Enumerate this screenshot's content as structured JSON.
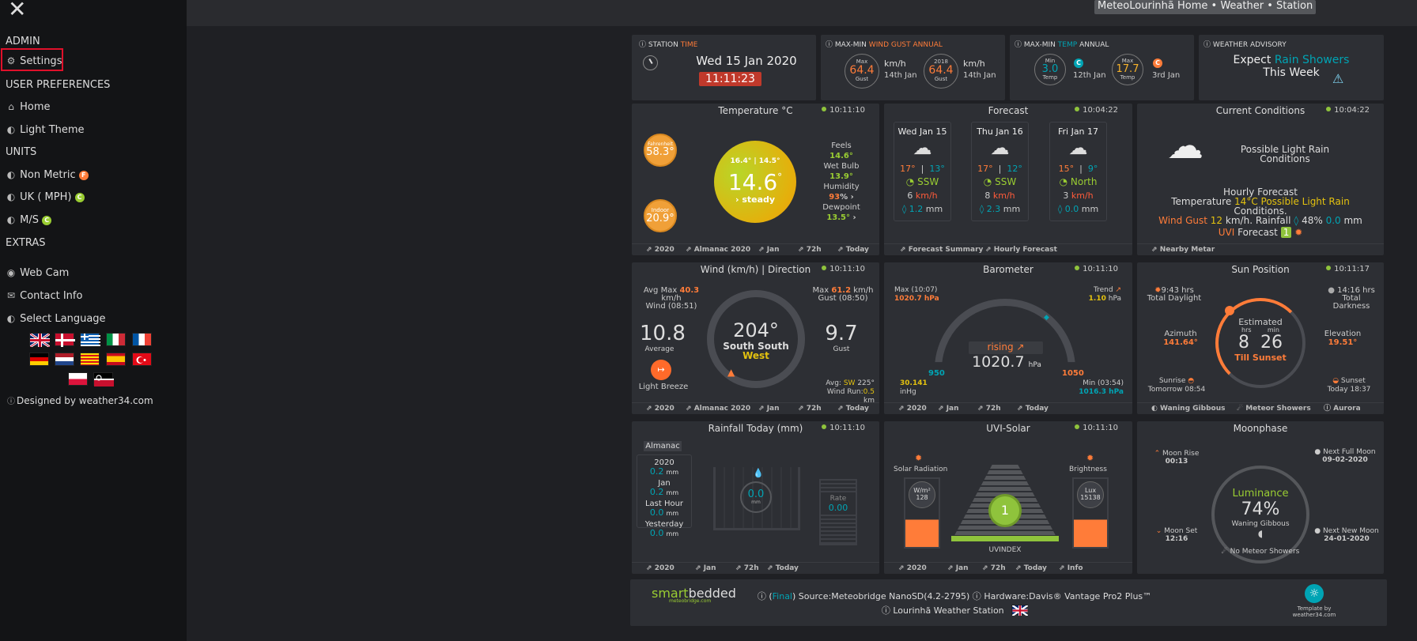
{
  "sidebar": {
    "admin": "ADMIN",
    "settings": "Settings",
    "user_prefs": "USER PREFERENCES",
    "home": "Home",
    "light_theme": "Light Theme",
    "units": "UNITS",
    "non_metric": "Non Metric",
    "non_metric_badge": "F",
    "uk": "UK ( MPH)",
    "uk_badge": "C",
    "ms": "M/S",
    "ms_badge": "C",
    "extras": "EXTRAS",
    "webcam": "Web Cam",
    "contact": "Contact Info",
    "language": "Select Language",
    "designed": "Designed by weather34.com"
  },
  "header": {
    "title": "MeteoLourinhã Home • Weather • Station"
  },
  "station": {
    "title1": "STATION",
    "title2": "TIME",
    "date": "Wed 15 Jan 2020",
    "time": "11:11:23"
  },
  "gust": {
    "title1": "MAX-MIN",
    "title2": "WIND GUST ANNUAL",
    "c1_top": "Max",
    "c1_val": "64.4",
    "c1_bot": "Gust",
    "c1_unit": "km/h",
    "c1_date": "14th Jan",
    "c2_top": "2018",
    "c2_val": "64.4",
    "c2_bot": "Gust",
    "c2_unit": "km/h",
    "c2_date": "14th Jan"
  },
  "tempannual": {
    "title1": "MAX-MIN",
    "title2": "TEMP",
    "title3": "ANNUAL",
    "c1_top": "Min",
    "c1_val": "3.0",
    "c1_bot": "Temp",
    "c1_date": "12th Jan",
    "c2_top": "Max",
    "c2_val": "17.7",
    "c2_bot": "Temp",
    "c2_date": "3rd Jan",
    "badge": "C"
  },
  "advisory": {
    "title": "WEATHER ADVISORY",
    "l1a": "Expect",
    "l1b": "Rain Showers",
    "l2": "This Week"
  },
  "temperature": {
    "title": "Temperature °C",
    "time": "10:11:10",
    "fah_label": "Fahrenheit",
    "fah_val": "58.3°",
    "in_label": "Indoor",
    "in_val": "20.9°",
    "hilo": "16.4° | 14.5°",
    "value": "14.6",
    "deg": "°",
    "trend": "steady",
    "feels_label": "Feels",
    "feels": "14.6°",
    "wetbulb_label": "Wet Bulb",
    "wetbulb": "13.9°",
    "humidity_label": "Humidity",
    "humidity": "93",
    "humidity_unit": "%",
    "dew_label": "Dewpoint",
    "dew": "13.5°",
    "f1": "2020",
    "f2": "Almanac 2020",
    "f3": "Jan",
    "f4": "72h",
    "f5": "Today"
  },
  "forecast": {
    "title": "Forecast",
    "time": "10:04:22",
    "days": [
      {
        "day": "Wed Jan 15",
        "hi": "17°",
        "lo": "13°",
        "dir": "SSW",
        "wind": "6",
        "wunit": "km/h",
        "rain": "1.2",
        "runit": "mm"
      },
      {
        "day": "Thu Jan 16",
        "hi": "17°",
        "lo": "12°",
        "dir": "SSW",
        "wind": "8",
        "wunit": "km/h",
        "rain": "2.3",
        "runit": "mm"
      },
      {
        "day": "Fri Jan 17",
        "hi": "15°",
        "lo": "9°",
        "dir": "North",
        "wind": "3",
        "wunit": "km/h",
        "rain": "0.0",
        "runit": "mm"
      }
    ],
    "f1": "Forecast Summary",
    "f2": "Hourly Forecast"
  },
  "current": {
    "title": "Current Conditions",
    "time": "10:04:22",
    "desc": "Possible Light Rain Conditions",
    "hf_title": "Hourly Forecast",
    "temp_label": "Temperature",
    "temp": "14°C",
    "cond": "Possible Light Rain",
    "cond2": "Conditions.",
    "gust_label": "Wind Gust",
    "gust": "12",
    "gust_unit": "km/h.",
    "rain_label": "Rainfall",
    "rain_pct": "48%",
    "rain": "0.0",
    "rain_unit": "mm",
    "uvi_label": "UVI",
    "uvi_fc": "Forecast",
    "uvi": "1",
    "f1": "Nearby Metar"
  },
  "wind": {
    "title": "Wind (km/h) | Direction",
    "time": "10:11:10",
    "avgmax_label": "Avg Max",
    "avgmax": "40.3",
    "avgmax_unit": "km/h",
    "avgmax_sub": "Wind (08:51)",
    "max_label": "Max",
    "max": "61.2",
    "max_unit": "km/h",
    "max_sub": "Gust (08:50)",
    "avg": "10.8",
    "avg_label": "Average",
    "deg": "204°",
    "dir1": "South South",
    "dir2": "West",
    "gust": "9.7",
    "gust_label": "Gust",
    "beaufort": "Light Breeze",
    "avgdir_label": "Avg:",
    "avgdir": "SW",
    "avgdir_deg": "225°",
    "run_label": "Wind Run:",
    "run": "0.5",
    "run_unit": "km",
    "f1": "2020",
    "f2": "Almanac 2020",
    "f3": "Jan",
    "f4": "72h",
    "f5": "Today"
  },
  "barometer": {
    "title": "Barometer",
    "time": "10:11:10",
    "max_label": "Max (10:07)",
    "max": "1020.7 hPa",
    "trend_label": "Trend",
    "trend": "1.10",
    "trend_unit": "hPa",
    "state": "rising",
    "value": "1020.7",
    "unit": "hPa",
    "low": "950",
    "high": "1050",
    "inhg": "30.141",
    "inhg_unit": "inHg",
    "min_label": "Min (03:54)",
    "min": "1016.3 hPa",
    "f1": "2020",
    "f2": "Jan",
    "f3": "72h",
    "f4": "Today"
  },
  "sun": {
    "title": "Sun Position",
    "time": "10:11:17",
    "daylight": "9:43 hrs",
    "daylight_label": "Total Daylight",
    "darkness": "14:16 hrs",
    "darkness_label": "Total Darkness",
    "az_label": "Azimuth",
    "az": "141.64°",
    "el_label": "Elevation",
    "el": "19.51°",
    "est": "Estimated",
    "hrs_label": "hrs",
    "min_label": "min",
    "hrs": "8",
    "mins": "26",
    "till": "Till Sunset",
    "sunrise_label": "Sunrise",
    "sunrise": "Tomorrow 08:54",
    "sunset_label": "Sunset",
    "sunset": "Today 18:37",
    "f1": "Waning Gibbous",
    "f2": "Meteor Showers",
    "f3": "Aurora"
  },
  "rain": {
    "title": "Rainfall Today (mm)",
    "time": "10:11:10",
    "almanac": "Almanac",
    "y": "2020",
    "y_val": "0.2",
    "mm": "mm",
    "m": "Jan",
    "m_val": "0.2",
    "lh": "Last Hour",
    "lh_val": "0.0",
    "yd": "Yesterday",
    "yd_val": "0.0",
    "value": "0.0",
    "unit": "mm",
    "rate_label": "Rate",
    "rate": "0.00",
    "f1": "2020",
    "f2": "Jan",
    "f3": "72h",
    "f4": "Today"
  },
  "uvi": {
    "title": "UVI-Solar",
    "time": "10:11:10",
    "solar_label": "Solar Radiation",
    "solar_unit": "W/m²",
    "solar": "128",
    "bright_label": "Brightness",
    "lux_label": "Lux",
    "lux": "15138",
    "uvi": "1",
    "uvi_label": "UVINDEX",
    "f1": "2020",
    "f2": "Jan",
    "f3": "72h",
    "f4": "Today",
    "f5": "Info"
  },
  "moon": {
    "title": "Moonphase",
    "rise_label": "Moon Rise",
    "rise": "00:13",
    "full_label": "Next Full Moon",
    "full": "09-02-2020",
    "lum_label": "Luminance",
    "lum": "74%",
    "phase": "Waning Gibbous",
    "set_label": "Moon Set",
    "set": "12:16",
    "new_label": "Next New Moon",
    "new": "24-01-2020",
    "meteor": "No Meteor Showers"
  },
  "footer": {
    "brand1": "smart",
    "brand2": "bedded",
    "brand_sub": "meteobridge.com",
    "final": "Final",
    "source": "Source:Meteobridge NanoSD(4.2-2795)",
    "hardware": "Hardware:Davis® Vantage Pro2 Plus™",
    "station": "Lourinhã Weather Station",
    "template": "Template by",
    "template2": "weather34.com"
  }
}
